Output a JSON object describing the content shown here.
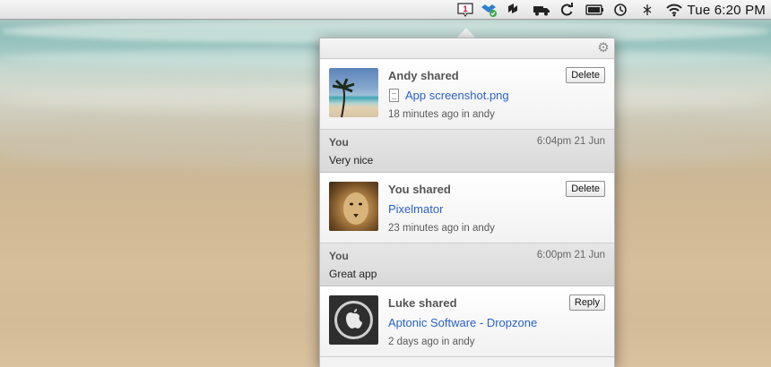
{
  "menubar": {
    "icons": [
      "notification-badge-icon",
      "dropbox-icon",
      "sync-icon",
      "truck-icon",
      "refresh-icon",
      "battery-icon",
      "time-machine-icon",
      "bluetooth-icon",
      "wifi-icon"
    ],
    "badge_count": "1",
    "clock": "Tue 6:20 PM"
  },
  "panel": {
    "items": [
      {
        "title": "Andy shared",
        "link": "App screenshot.png",
        "meta": "18 minutes ago in andy",
        "button": "Delete"
      },
      {
        "title": "You shared",
        "link": "Pixelmator",
        "meta": "23 minutes ago in andy",
        "button": "Delete"
      },
      {
        "title": "Luke shared",
        "link": "Aptonic Software - Dropzone",
        "meta": "2 days ago in andy",
        "button": "Reply"
      }
    ],
    "comments": [
      {
        "author": "You",
        "time": "6:04pm 21 Jun",
        "text": "Very nice"
      },
      {
        "author": "You",
        "time": "6:00pm 21 Jun",
        "text": "Great app"
      }
    ]
  },
  "colors": {
    "link": "#2a61c9",
    "panel_bg": "#f3f3f3",
    "comment_bg": "#e0e0e0"
  }
}
